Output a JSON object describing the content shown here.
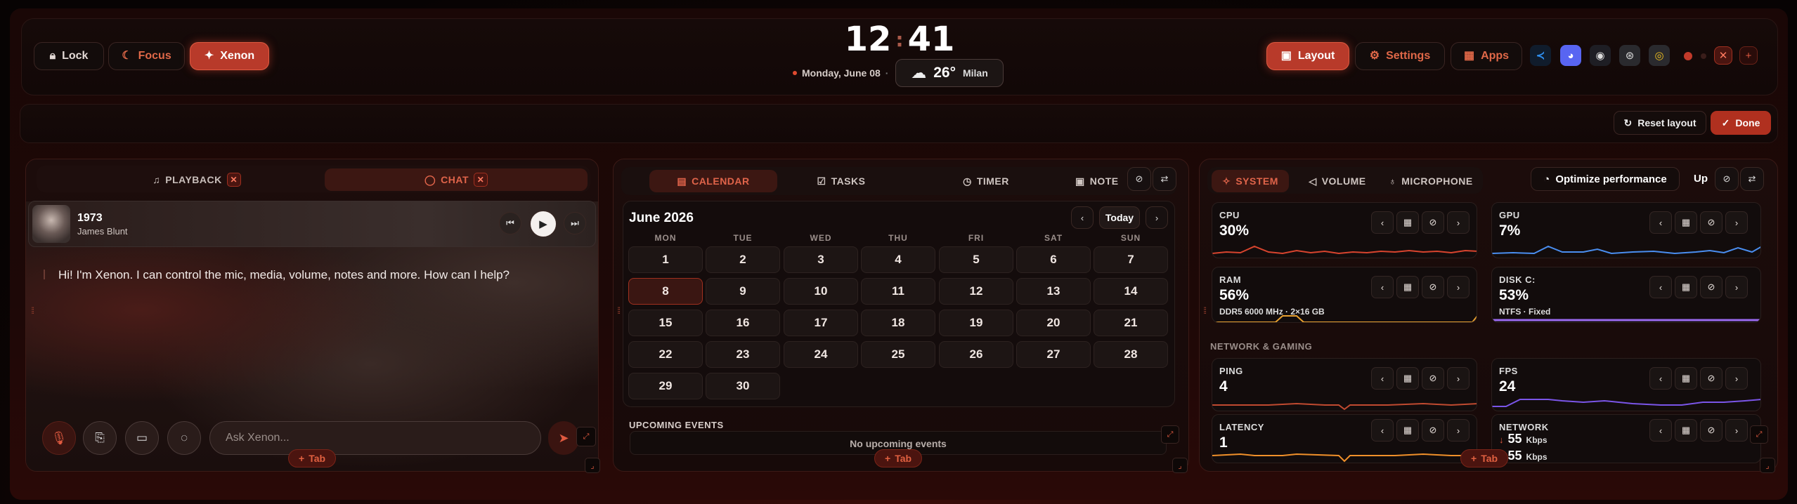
{
  "top_left": {
    "lock_label": "Lock",
    "focus_label": "Focus",
    "xenon_label": "Xenon"
  },
  "clock": {
    "hours": "12",
    "separator": ":",
    "minutes": "41",
    "date": "Monday, June 08",
    "temp": "26°",
    "city": "Milan"
  },
  "top_right": {
    "layout_label": "Layout",
    "settings_label": "Settings",
    "apps_label": "Apps",
    "apps": [
      "vscode-icon",
      "discord-icon",
      "obs-icon",
      "steam-icon",
      "chrome-icon"
    ]
  },
  "edit_bar": {
    "reset_label": "Reset layout",
    "done_label": "Done"
  },
  "panel1": {
    "tab1": "PLAYBACK",
    "tab2": "CHAT",
    "track_title": "1973",
    "track_artist": "James Blunt",
    "chat_message": "Hi! I'm Xenon. I can control the mic, media, volume, notes and more. How can I help?",
    "input_placeholder": "Ask Xenon...",
    "add_tab": "Tab"
  },
  "panel2": {
    "tabs": [
      "CALENDAR",
      "TASKS",
      "TIMER",
      "NOTE"
    ],
    "month": "June 2026",
    "today_label": "Today",
    "weekdays": [
      "MON",
      "TUE",
      "WED",
      "THU",
      "FRI",
      "SAT",
      "SUN"
    ],
    "days": [
      "1",
      "2",
      "3",
      "4",
      "5",
      "6",
      "7",
      "8",
      "9",
      "10",
      "11",
      "12",
      "13",
      "14",
      "15",
      "16",
      "17",
      "18",
      "19",
      "20",
      "21",
      "22",
      "23",
      "24",
      "25",
      "26",
      "27",
      "28",
      "29",
      "30"
    ],
    "selected_day": "8",
    "upcoming_title": "UPCOMING EVENTS",
    "upcoming_empty": "No upcoming events",
    "add_tab": "Tab"
  },
  "panel3": {
    "tabs": [
      "SYSTEM",
      "VOLUME",
      "MICROPHONE"
    ],
    "optimize_label": "Optimize performance",
    "up_label": "Up",
    "section_network": "NETWORK & GAMING",
    "cpu": {
      "label": "CPU",
      "value": "30%"
    },
    "gpu": {
      "label": "GPU",
      "value": "7%"
    },
    "ram": {
      "label": "RAM",
      "value": "56%",
      "sub": "DDR5 6000 MHz · 2×16 GB"
    },
    "disk": {
      "label": "DISK C:",
      "value": "53%",
      "sub": "NTFS · Fixed"
    },
    "ping": {
      "label": "PING",
      "value": "4"
    },
    "fps": {
      "label": "FPS",
      "value": "24"
    },
    "latency": {
      "label": "LATENCY",
      "value": "1"
    },
    "network": {
      "label": "NETWORK",
      "down": "55",
      "up": "55",
      "unit": "Kbps"
    },
    "add_tab": "Tab"
  },
  "colors": {
    "accent": "#c0402c",
    "cpu_line": "#d8442e",
    "gpu_line": "#4a8ef0",
    "disk_line": "#9a6af0",
    "fps_line": "#7a55e8",
    "latency_line": "#f0902a"
  }
}
